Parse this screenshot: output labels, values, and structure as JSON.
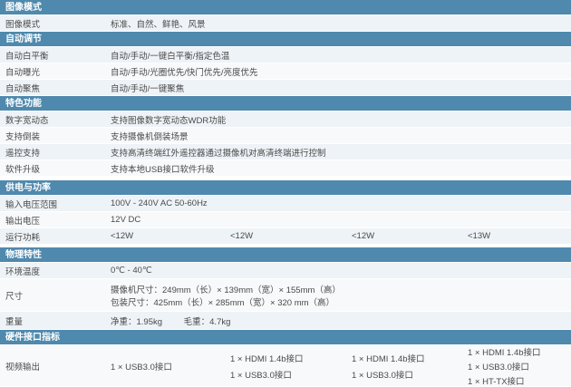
{
  "sections": {
    "image_mode": {
      "title": "图像模式",
      "label": "图像模式",
      "value": "标准、自然、鲜艳、风景"
    },
    "auto_adjust": {
      "title": "自动调节",
      "rows": [
        {
          "label": "自动白平衡",
          "value": "自动/手动/一键白平衡/指定色温"
        },
        {
          "label": "自动曝光",
          "value": "自动/手动/光圈优先/快门优先/亮度优先"
        },
        {
          "label": "自动聚焦",
          "value": "自动/手动/一键聚焦"
        }
      ]
    },
    "features": {
      "title": "特色功能",
      "rows": [
        {
          "label": "数字宽动态",
          "value": "支持图像数字宽动态WDR功能"
        },
        {
          "label": "支持倒装",
          "value": "支持摄像机倒装场景"
        },
        {
          "label": "遥控支持",
          "value": "支持高清终端红外遥控器通过摄像机对高清终端进行控制"
        },
        {
          "label": "软件升级",
          "value": "支持本地USB接口软件升级"
        }
      ]
    },
    "power": {
      "title": "供电与功率",
      "input_label": "输入电压范围",
      "input_value": "100V - 240V AC 50-60Hz",
      "output_label": "输出电压",
      "output_value": "12V DC",
      "consumption_label": "运行功耗",
      "consumption_values": [
        "<12W",
        "<12W",
        "<12W",
        "<13W"
      ]
    },
    "physical": {
      "title": "物理特性",
      "temp_label": "环境温度",
      "temp_value": "0℃ - 40℃",
      "size_label": "尺寸",
      "size_camera": "摄像机尺寸：249mm（长）× 139mm（宽）× 155mm（高）",
      "size_package": "包装尺寸：425mm（长）× 285mm（宽）× 320 mm（高）",
      "weight_label": "重量",
      "weight_net": "净重：1.95kg",
      "weight_gross": "毛重：4.7kg"
    },
    "hardware": {
      "title": "硬件接口指标",
      "video_label": "视频输出",
      "col1": [
        "1 × USB3.0接口"
      ],
      "col2": [
        "1 × HDMI 1.4b接口",
        "1 × USB3.0接口"
      ],
      "col3": [
        "1 × HDMI 1.4b接口",
        "1 × USB3.0接口"
      ],
      "col4": [
        "1 × HDMI 1.4b接口",
        "1 × USB3.0接口",
        "1 × HT-TX接口"
      ]
    }
  }
}
